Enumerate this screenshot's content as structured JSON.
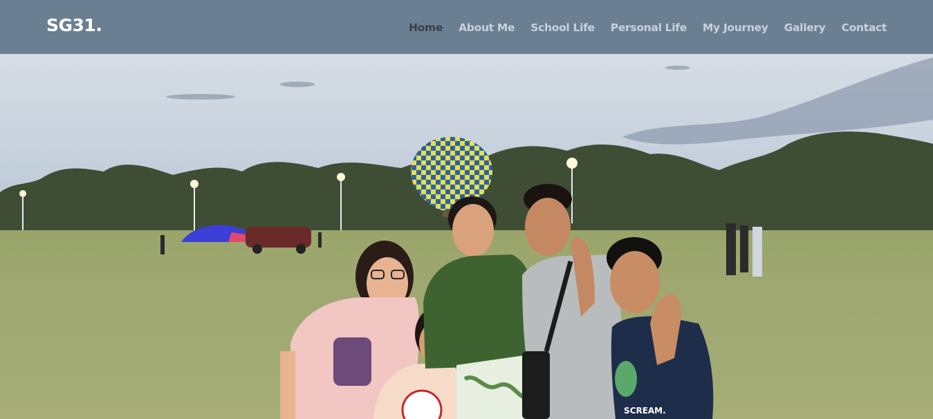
{
  "site": {
    "brand": "SG31."
  },
  "nav": {
    "items": [
      {
        "label": "Home",
        "active": true
      },
      {
        "label": "About Me",
        "active": false
      },
      {
        "label": "School Life",
        "active": false
      },
      {
        "label": "Personal Life",
        "active": false
      },
      {
        "label": "My Journey",
        "active": false
      },
      {
        "label": "Gallery",
        "active": false
      },
      {
        "label": "Contact",
        "active": false
      }
    ]
  },
  "hero": {
    "shirt_text": "SCREAM."
  },
  "colors": {
    "navbar_bg": "#6b7f93",
    "nav_link": "#c9d1da",
    "nav_active": "#3a3f44",
    "sky": "#c9d3df",
    "grass": "#a9b07a",
    "balloon_yellow": "#e6e24a",
    "balloon_blue": "#2f5fa8"
  }
}
